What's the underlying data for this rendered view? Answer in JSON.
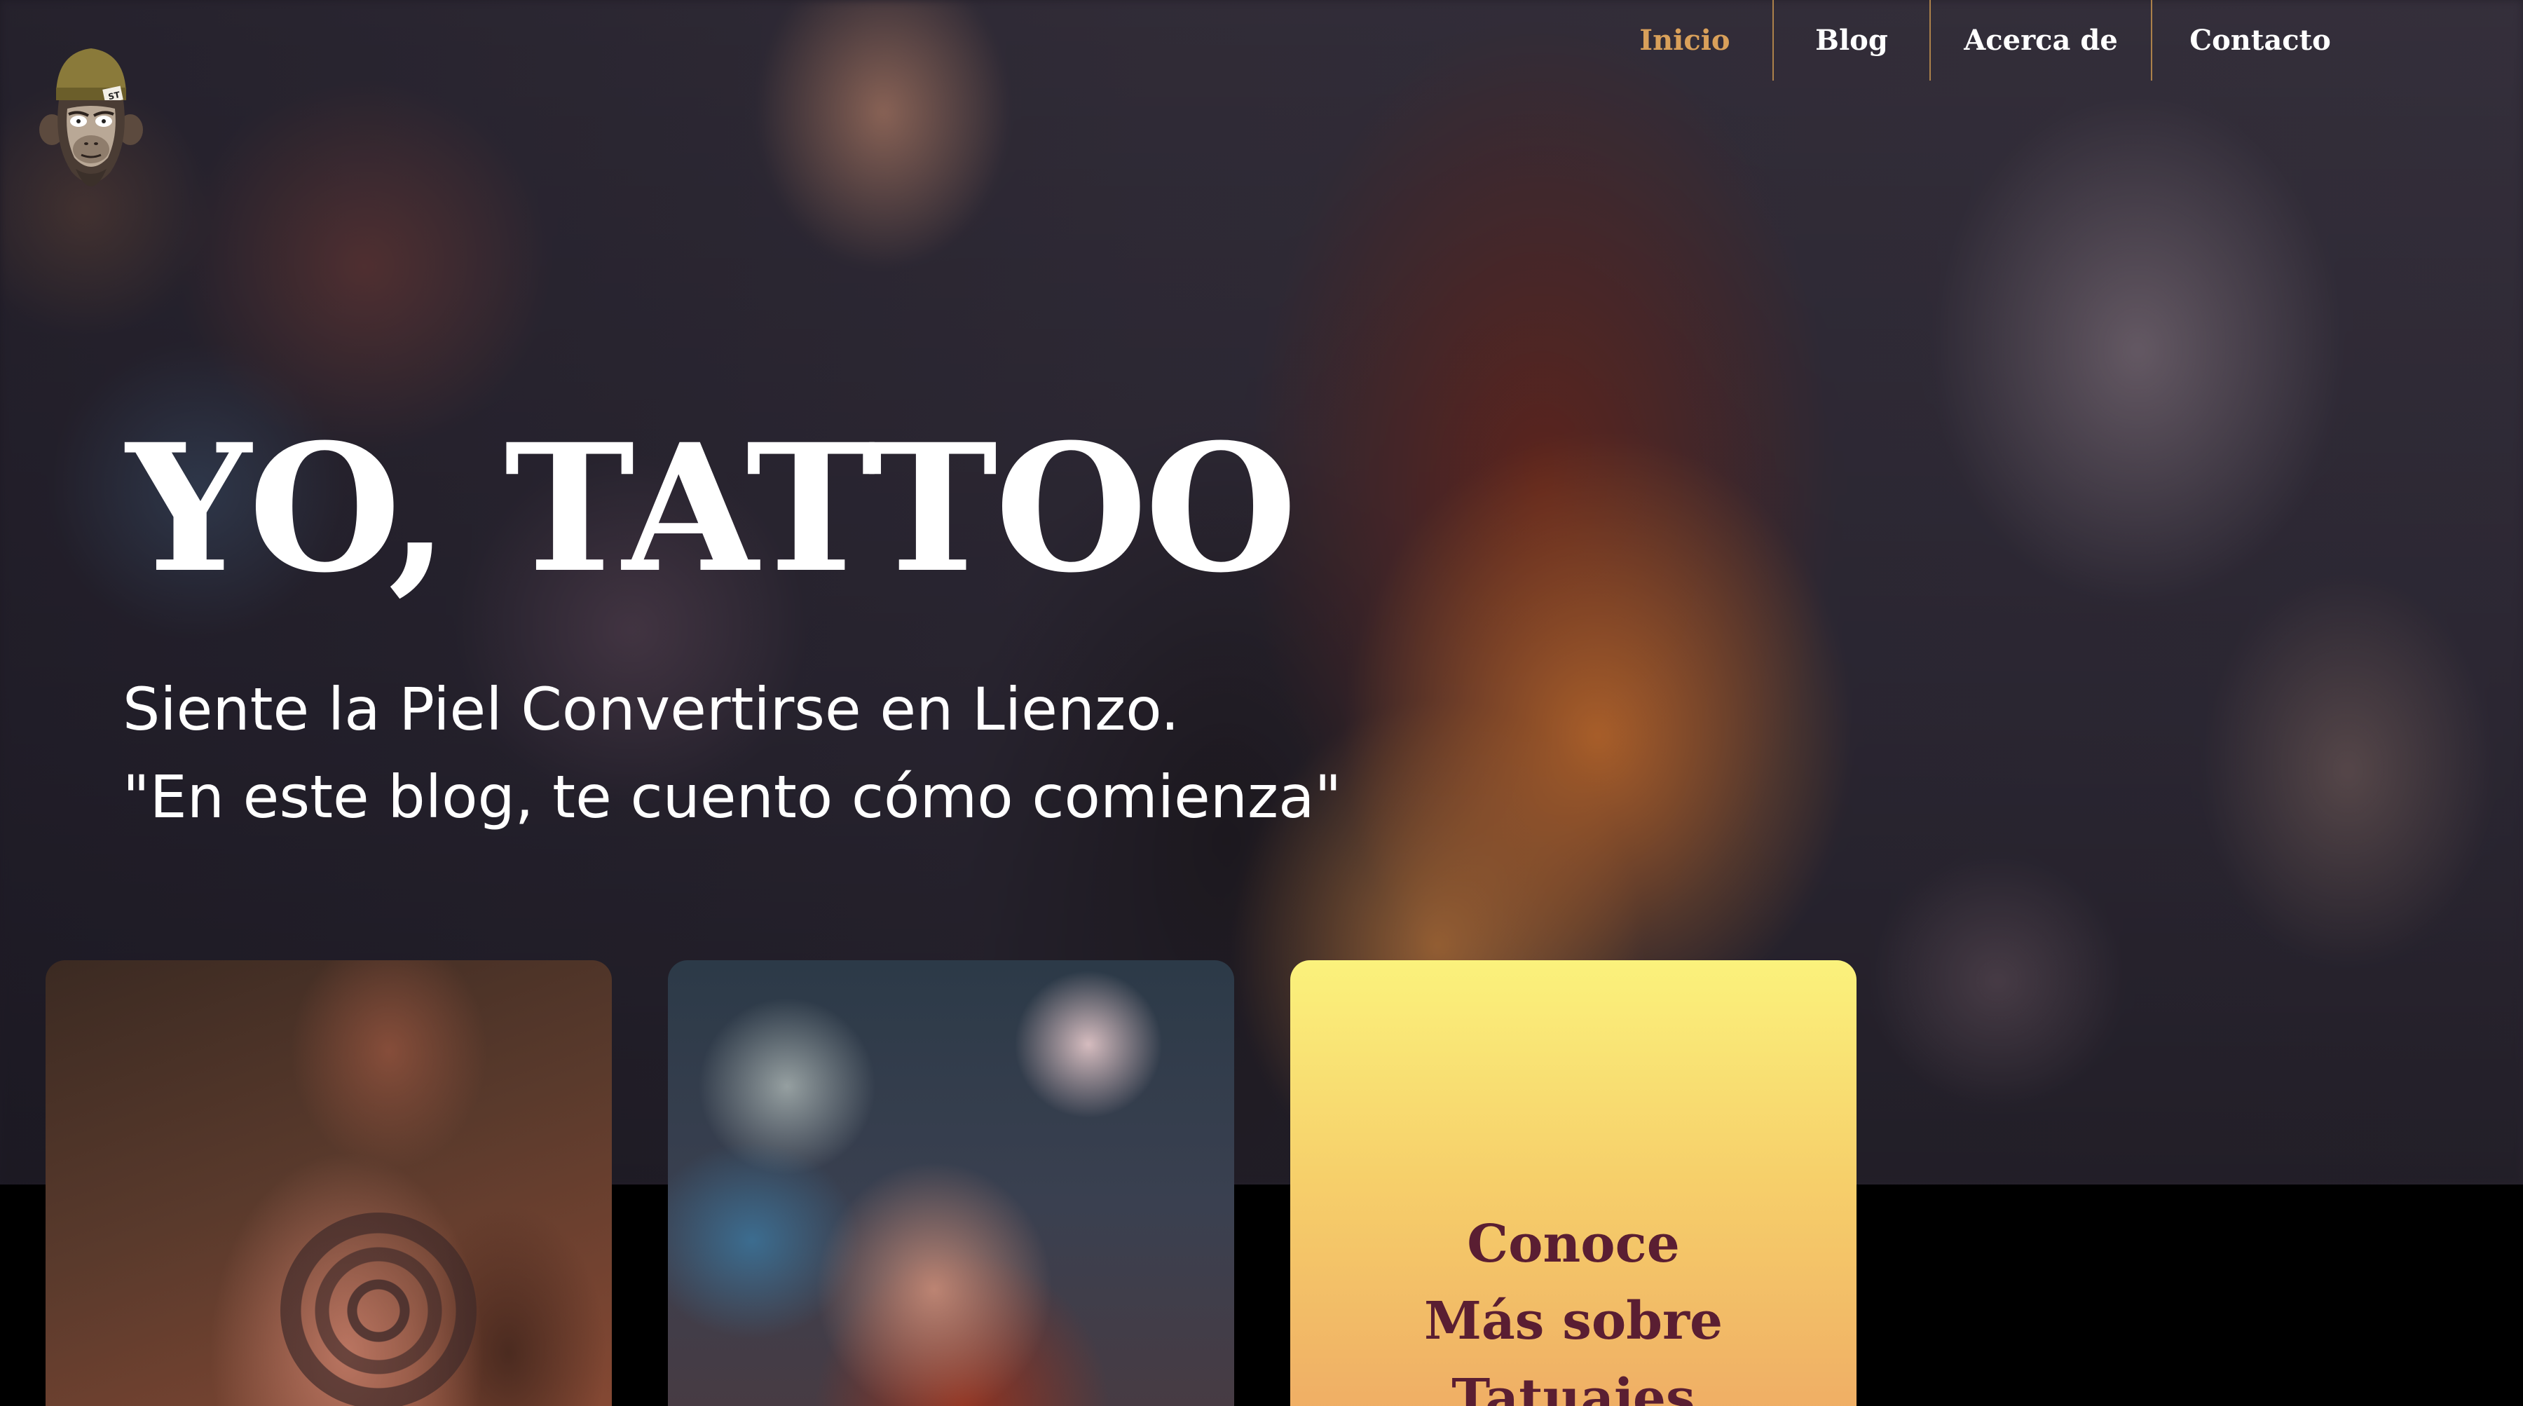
{
  "nav": {
    "items": [
      {
        "label": "Inicio",
        "active": true
      },
      {
        "label": "Blog",
        "active": false
      },
      {
        "label": "Acerca de",
        "active": false
      },
      {
        "label": "Contacto",
        "active": false
      }
    ]
  },
  "hero": {
    "title": "YO, TATTOO",
    "subtitle_line1": "Siente la Piel Convertirse en Lienzo.",
    "subtitle_line2": " \"En este blog, te cuento cómo comienza\""
  },
  "cards": {
    "promo_line1": "Conoce",
    "promo_line2": "Más sobre",
    "promo_line3": "Tatuajes"
  },
  "colors": {
    "nav_active": "#d9a05a",
    "nav_divider": "#d69e50",
    "promo_text": "#5a1e32",
    "promo_gradient_top": "#fbf27c",
    "promo_gradient_bottom": "#eea864"
  },
  "icons": {
    "logo": "monkey-beanie-logo-icon"
  }
}
